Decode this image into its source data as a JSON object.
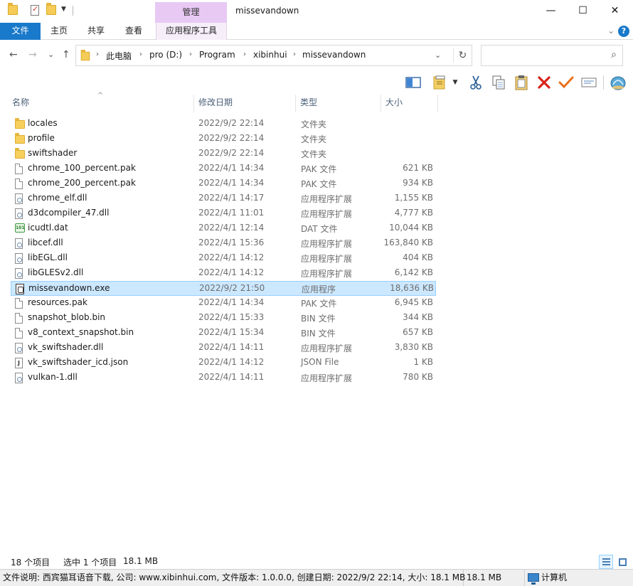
{
  "window": {
    "title": "missevandown",
    "manage_tab": "管理",
    "minimize": "—",
    "maximize": "☐",
    "close": "✕"
  },
  "ribbon": {
    "tabs": [
      "文件",
      "主页",
      "共享",
      "查看",
      "应用程序工具"
    ],
    "chevron": "⌄",
    "help": "?"
  },
  "nav": {
    "back": "←",
    "forward": "→",
    "recent": "⌄",
    "up": "↑"
  },
  "address": {
    "crumbs": [
      "此电脑",
      "pro (D:)",
      "Program",
      "xibinhui",
      "missevandown"
    ],
    "separator": "›",
    "dropdown": "⌄",
    "refresh": "↻"
  },
  "search": {
    "placeholder": "",
    "icon": "⌕"
  },
  "toolbar_icons": [
    "preview-pane-icon",
    "properties-icon",
    "cut-icon",
    "copy-icon",
    "paste-icon",
    "delete-icon",
    "check-icon",
    "rename-icon",
    "shell-icon"
  ],
  "columns": {
    "name": "名称",
    "date": "修改日期",
    "type": "类型",
    "size": "大小",
    "sort_indicator": "^"
  },
  "files": [
    {
      "name": "locales",
      "date": "2022/9/2 22:14",
      "type": "文件夹",
      "size": "",
      "icon": "folder"
    },
    {
      "name": "profile",
      "date": "2022/9/2 22:14",
      "type": "文件夹",
      "size": "",
      "icon": "folder"
    },
    {
      "name": "swiftshader",
      "date": "2022/9/2 22:14",
      "type": "文件夹",
      "size": "",
      "icon": "folder"
    },
    {
      "name": "chrome_100_percent.pak",
      "date": "2022/4/1 14:34",
      "type": "PAK 文件",
      "size": "621 KB",
      "icon": "file"
    },
    {
      "name": "chrome_200_percent.pak",
      "date": "2022/4/1 14:34",
      "type": "PAK 文件",
      "size": "934 KB",
      "icon": "file"
    },
    {
      "name": "chrome_elf.dll",
      "date": "2022/4/1 14:17",
      "type": "应用程序扩展",
      "size": "1,155 KB",
      "icon": "dll"
    },
    {
      "name": "d3dcompiler_47.dll",
      "date": "2022/4/1 11:01",
      "type": "应用程序扩展",
      "size": "4,777 KB",
      "icon": "dll"
    },
    {
      "name": "icudtl.dat",
      "date": "2022/4/1 12:14",
      "type": "DAT 文件",
      "size": "10,044 KB",
      "icon": "dat"
    },
    {
      "name": "libcef.dll",
      "date": "2022/4/1 15:36",
      "type": "应用程序扩展",
      "size": "163,840 KB",
      "icon": "dll"
    },
    {
      "name": "libEGL.dll",
      "date": "2022/4/1 14:12",
      "type": "应用程序扩展",
      "size": "404 KB",
      "icon": "dll"
    },
    {
      "name": "libGLESv2.dll",
      "date": "2022/4/1 14:12",
      "type": "应用程序扩展",
      "size": "6,142 KB",
      "icon": "dll"
    },
    {
      "name": "missevandown.exe",
      "date": "2022/9/2 21:50",
      "type": "应用程序",
      "size": "18,636 KB",
      "icon": "exe",
      "selected": true
    },
    {
      "name": "resources.pak",
      "date": "2022/4/1 14:34",
      "type": "PAK 文件",
      "size": "6,945 KB",
      "icon": "file"
    },
    {
      "name": "snapshot_blob.bin",
      "date": "2022/4/1 15:33",
      "type": "BIN 文件",
      "size": "344 KB",
      "icon": "file"
    },
    {
      "name": "v8_context_snapshot.bin",
      "date": "2022/4/1 15:34",
      "type": "BIN 文件",
      "size": "657 KB",
      "icon": "file"
    },
    {
      "name": "vk_swiftshader.dll",
      "date": "2022/4/1 14:11",
      "type": "应用程序扩展",
      "size": "3,830 KB",
      "icon": "dll"
    },
    {
      "name": "vk_swiftshader_icd.json",
      "date": "2022/4/1 14:12",
      "type": "JSON File",
      "size": "1 KB",
      "icon": "json"
    },
    {
      "name": "vulkan-1.dll",
      "date": "2022/4/1 14:11",
      "type": "应用程序扩展",
      "size": "780 KB",
      "icon": "dll"
    }
  ],
  "status": {
    "item_count": "18 个项目",
    "selected": "选中 1 个项目",
    "selected_size": "18.1 MB"
  },
  "infobar": {
    "description": "文件说明: 西宾猫耳语音下载, 公司: www.xibinhui.com, 文件版本: 1.0.0.0, 创建日期: 2022/9/2 22:14, 大小: 18.1 MB",
    "size": "18.1 MB",
    "location": "计算机"
  }
}
